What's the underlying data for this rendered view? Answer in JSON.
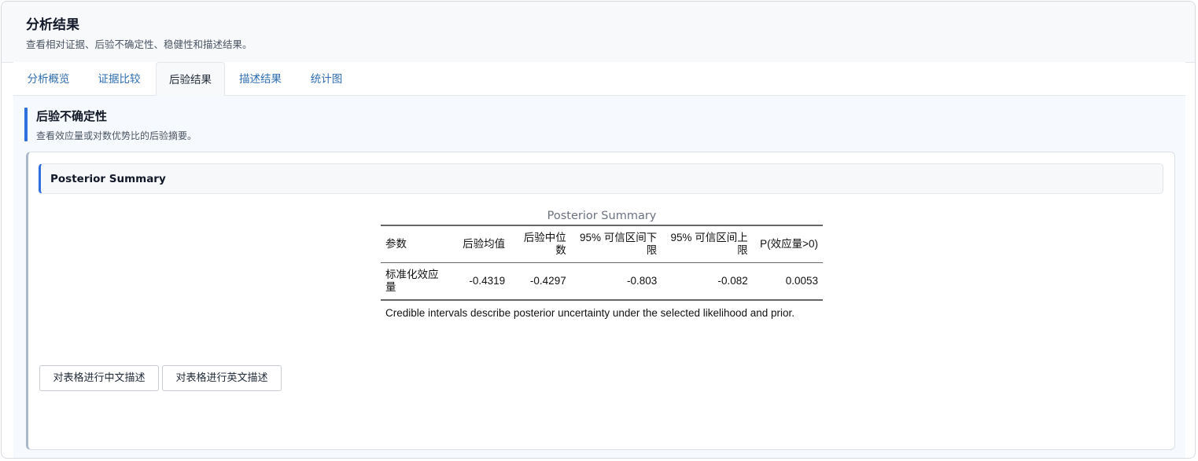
{
  "header": {
    "title": "分析结果",
    "subtitle": "查看相对证据、后验不确定性、稳健性和描述结果。"
  },
  "tabs": [
    {
      "label": "分析概览",
      "active": false
    },
    {
      "label": "证据比较",
      "active": false
    },
    {
      "label": "后验结果",
      "active": true
    },
    {
      "label": "描述结果",
      "active": false
    },
    {
      "label": "统计图",
      "active": false
    }
  ],
  "section": {
    "title": "后验不确定性",
    "subtitle": "查看效应量或对数优势比的后验摘要。"
  },
  "card": {
    "title": "Posterior Summary"
  },
  "table": {
    "caption": "Posterior Summary",
    "columns": [
      "参数",
      "后验均值",
      "后验中位数",
      "95% 可信区间下限",
      "95% 可信区间上限",
      "P(效应量>0)"
    ],
    "rows": [
      [
        "标准化效应量",
        "-0.4319",
        "-0.4297",
        "-0.803",
        "-0.082",
        "0.0053"
      ]
    ],
    "note": "Credible intervals describe posterior uncertainty under the selected likelihood and prior."
  },
  "buttons": {
    "describe_cn": "对表格进行中文描述",
    "describe_en": "对表格进行英文描述"
  },
  "colors": {
    "accent": "#2f6fde",
    "tab_link": "#2f6db0"
  }
}
